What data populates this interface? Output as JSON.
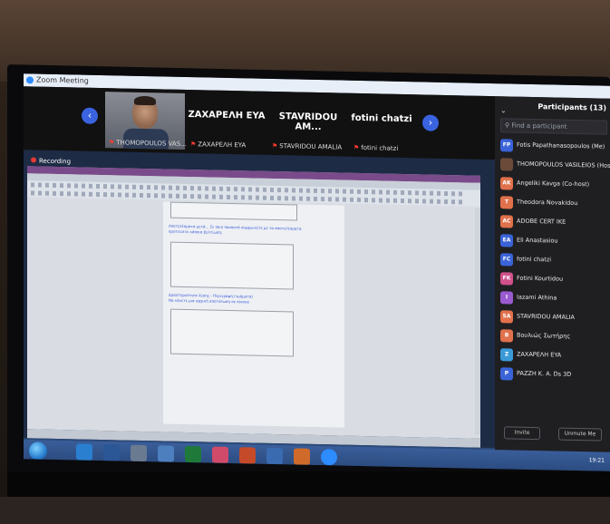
{
  "zoom": {
    "window_title": "Zoom Meeting",
    "recording_label": "Recording"
  },
  "gallery": {
    "prev_arrow": "‹",
    "next_arrow": "›",
    "tiles": [
      {
        "kind": "video",
        "name": "THOMOPOULOS VAS..."
      },
      {
        "kind": "name",
        "big": "ZAXAPEΛH EYA",
        "small": "ZAXAPEΛH EYA"
      },
      {
        "kind": "name",
        "big": "STAVRIDOU AM...",
        "small": "STAVRIDOU AMALIA"
      },
      {
        "kind": "name",
        "big": "fotini chatzi",
        "small": "fotini chatzi"
      }
    ]
  },
  "document": {
    "text_line1": "Αποτελέσματα μετά... Σε ποιο ποσοστό συμφωνείτε με τα αποτελέσματα",
    "text_line2": "προτείνετε κάποια βελτίωση;",
    "text_line3": "Δραστηριότητα λύσης - Περιγραφή (τμήματα)",
    "text_line4": "Να κάνετε μια αρχική αποτύπωση σε πίνακα"
  },
  "participants": {
    "header": "Participants (13)",
    "search_placeholder": "Find a participant",
    "items": [
      {
        "initials": "FP",
        "name": "Fotis Papathanasopoulos (Me)",
        "color": "#3a63d8"
      },
      {
        "initials": "",
        "name": "THOMOPOULOS VASILEIOS (Host)",
        "color": "#6b4a3a"
      },
      {
        "initials": "AK",
        "name": "Angeliki Kavga (Co-host)",
        "color": "#e0714b"
      },
      {
        "initials": "T",
        "name": "Theodora Novakidou",
        "color": "#e0714b"
      },
      {
        "initials": "AC",
        "name": "ADOBE CERT IKE",
        "color": "#e0714b"
      },
      {
        "initials": "EA",
        "name": "Eli Anastasiou",
        "color": "#3a63d8"
      },
      {
        "initials": "FC",
        "name": "fotini chatzi",
        "color": "#3a63d8"
      },
      {
        "initials": "FK",
        "name": "Fotini Kourtidou",
        "color": "#d0508a"
      },
      {
        "initials": "I",
        "name": "Iazami Athina",
        "color": "#9a5ad0"
      },
      {
        "initials": "SA",
        "name": "STAVRIDOU AMALIA",
        "color": "#e0714b"
      },
      {
        "initials": "B",
        "name": "Βουλιώς Σωτήρης",
        "color": "#e0714b"
      },
      {
        "initials": "Z",
        "name": "ZAXAPEΛH EYA",
        "color": "#3a9ad8"
      },
      {
        "initials": "P",
        "name": "PAZZH K. A. Ds 3D",
        "color": "#3a63d8"
      }
    ],
    "invite_label": "Invite",
    "unmute_label": "Unmute Me"
  },
  "taskbar": {
    "clock": "19:21"
  }
}
